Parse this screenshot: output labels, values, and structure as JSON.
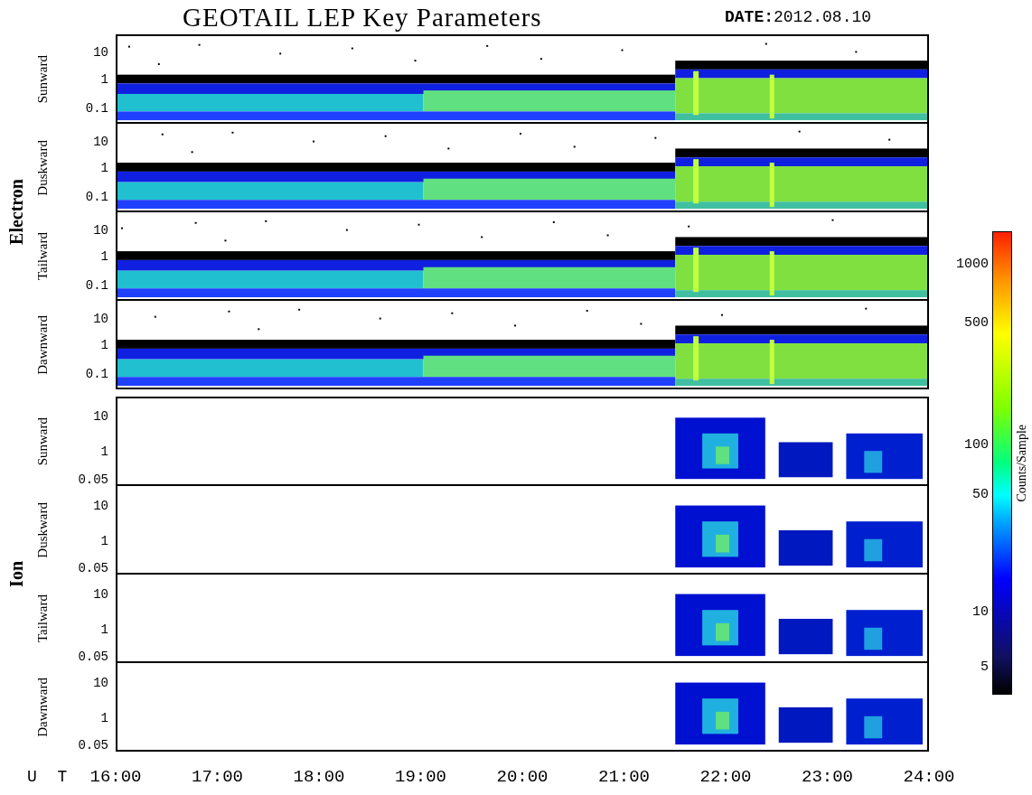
{
  "title": "GEOTAIL LEP Key Parameters",
  "date_label": "DATE:",
  "date": "2012.08.10",
  "groups": [
    {
      "name": "Electron",
      "kind": "electron",
      "panels": [
        {
          "direction": "Sunward",
          "yticks": [
            "10",
            "1",
            "0.1"
          ]
        },
        {
          "direction": "Duskward",
          "yticks": [
            "10",
            "1",
            "0.1"
          ]
        },
        {
          "direction": "Tailward",
          "yticks": [
            "10",
            "1",
            "0.1"
          ]
        },
        {
          "direction": "Dawnward",
          "yticks": [
            "10",
            "1",
            "0.1"
          ]
        }
      ]
    },
    {
      "name": "Ion",
      "kind": "ion",
      "panels": [
        {
          "direction": "Sunward",
          "yticks": [
            "10",
            "1",
            "0.05"
          ]
        },
        {
          "direction": "Duskward",
          "yticks": [
            "10",
            "1",
            "0.05"
          ]
        },
        {
          "direction": "Tailward",
          "yticks": [
            "10",
            "1",
            "0.05"
          ]
        },
        {
          "direction": "Dawnward",
          "yticks": [
            "10",
            "1",
            "0.05"
          ]
        }
      ]
    }
  ],
  "x_axis": {
    "label": "U T",
    "ticks": [
      "16:00",
      "17:00",
      "18:00",
      "19:00",
      "20:00",
      "21:00",
      "22:00",
      "23:00",
      "24:00"
    ]
  },
  "colorbar": {
    "label": "Counts/Sample",
    "ticks": [
      "1000",
      "500",
      "100",
      "50",
      "10",
      "5"
    ]
  }
}
